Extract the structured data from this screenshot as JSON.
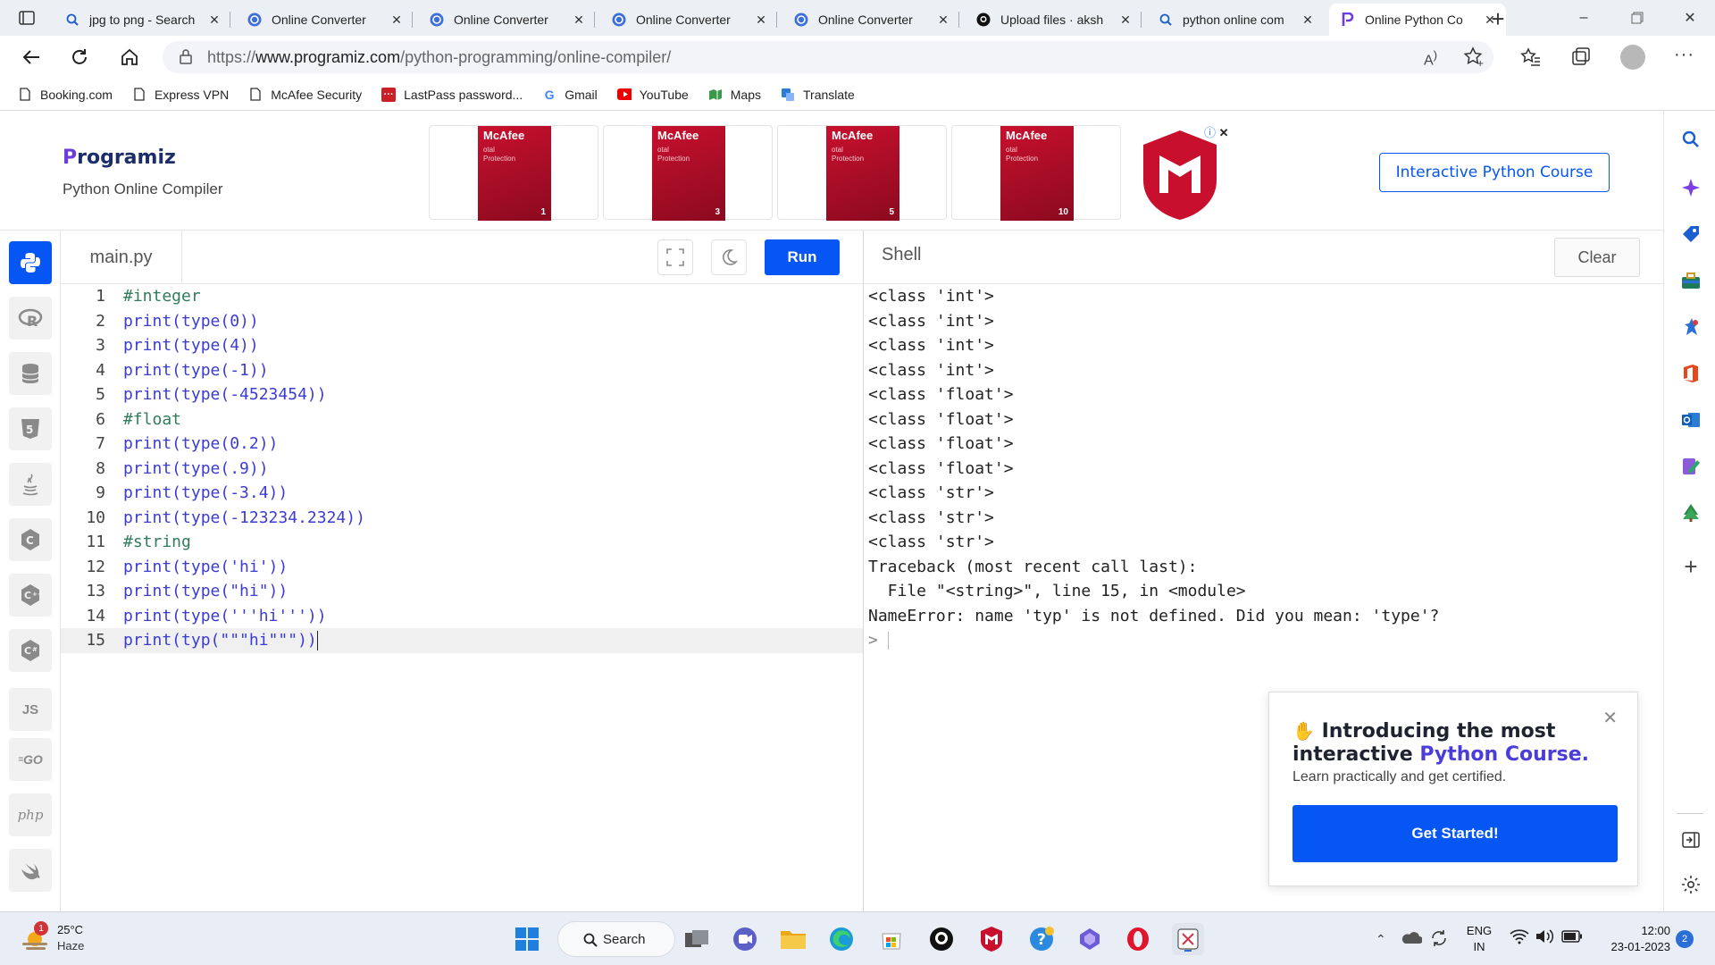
{
  "browser": {
    "tabs": [
      {
        "title": "jpg to png - Search",
        "icon": "search-icon"
      },
      {
        "title": "Online Converter",
        "icon": "converter-icon"
      },
      {
        "title": "Online Converter",
        "icon": "converter-icon"
      },
      {
        "title": "Online Converter",
        "icon": "converter-icon"
      },
      {
        "title": "Online Converter",
        "icon": "converter-icon"
      },
      {
        "title": "Upload files · aksh",
        "icon": "github-icon"
      },
      {
        "title": "python online com",
        "icon": "search-icon"
      },
      {
        "title": "Online Python Co",
        "icon": "programiz-icon",
        "active": true
      }
    ],
    "url_prefix": "https://",
    "url_host": "www.programiz.com",
    "url_path": "/python-programming/online-compiler/",
    "favorites": [
      "Booking.com",
      "Express VPN",
      "McAfee Security",
      "LastPass password...",
      "Gmail",
      "YouTube",
      "Maps",
      "Translate"
    ]
  },
  "header": {
    "logo_text": "rogramiz",
    "logo_mark": "P",
    "subtitle": "Python Online Compiler",
    "course_button": "Interactive Python Course",
    "ads": [
      {
        "brand": "McAfee",
        "product": "otal\nProtection",
        "devices": "1"
      },
      {
        "brand": "McAfee",
        "product": "otal\nProtection",
        "devices": "3"
      },
      {
        "brand": "McAfee",
        "product": "otal\nProtection",
        "devices": "5"
      },
      {
        "brand": "McAfee",
        "product": "otal\nProtection",
        "devices": "10"
      }
    ]
  },
  "languages": [
    "python",
    "R",
    "sql",
    "html",
    "java",
    "c",
    "c++",
    "c#",
    "JS",
    "GO",
    "php",
    "swift"
  ],
  "editor": {
    "file_name": "main.py",
    "run_label": "Run",
    "lines": [
      {
        "n": "1",
        "text": "#integer",
        "type": "comment"
      },
      {
        "n": "2",
        "text": "print(type(0))",
        "type": "code"
      },
      {
        "n": "3",
        "text": "print(type(4))",
        "type": "code"
      },
      {
        "n": "4",
        "text": "print(type(-1))",
        "type": "code"
      },
      {
        "n": "5",
        "text": "print(type(-4523454))",
        "type": "code"
      },
      {
        "n": "6",
        "text": "#float",
        "type": "comment"
      },
      {
        "n": "7",
        "text": "print(type(0.2))",
        "type": "code"
      },
      {
        "n": "8",
        "text": "print(type(.9))",
        "type": "code"
      },
      {
        "n": "9",
        "text": "print(type(-3.4))",
        "type": "code"
      },
      {
        "n": "10",
        "text": "print(type(-123234.2324))",
        "type": "code"
      },
      {
        "n": "11",
        "text": "#string",
        "type": "comment"
      },
      {
        "n": "12",
        "text": "print(type('hi'))",
        "type": "code"
      },
      {
        "n": "13",
        "text": "print(type(\"hi\"))",
        "type": "code"
      },
      {
        "n": "14",
        "text": "print(type('''hi'''))",
        "type": "code"
      },
      {
        "n": "15",
        "text": "print(typ(\"\"\"hi\"\"\"))",
        "type": "code",
        "active": true
      }
    ]
  },
  "shell": {
    "title": "Shell",
    "clear_label": "Clear",
    "output": [
      "<class 'int'>",
      "<class 'int'>",
      "<class 'int'>",
      "<class 'int'>",
      "<class 'float'>",
      "<class 'float'>",
      "<class 'float'>",
      "<class 'float'>",
      "<class 'str'>",
      "<class 'str'>",
      "<class 'str'>",
      "Traceback (most recent call last):",
      "  File \"<string>\", line 15, in <module>",
      "NameError: name 'typ' is not defined. Did you mean: 'type'?"
    ],
    "prompt": ">"
  },
  "promo": {
    "title_part1": "Introducing the most interactive ",
    "title_highlight": "Python Course.",
    "subtitle": "Learn practically and get certified.",
    "button": "Get Started!"
  },
  "taskbar": {
    "temperature": "25°C",
    "condition": "Haze",
    "weather_badge": "1",
    "search_label": "Search",
    "lang_line1": "ENG",
    "lang_line2": "IN",
    "time": "12:00",
    "date": "23-01-2023",
    "notifications": "2"
  },
  "colors": {
    "accent": "#0556f3",
    "comment": "#2f7d5a",
    "code": "#3b3bd6",
    "mcafee_red": "#c8102e"
  }
}
